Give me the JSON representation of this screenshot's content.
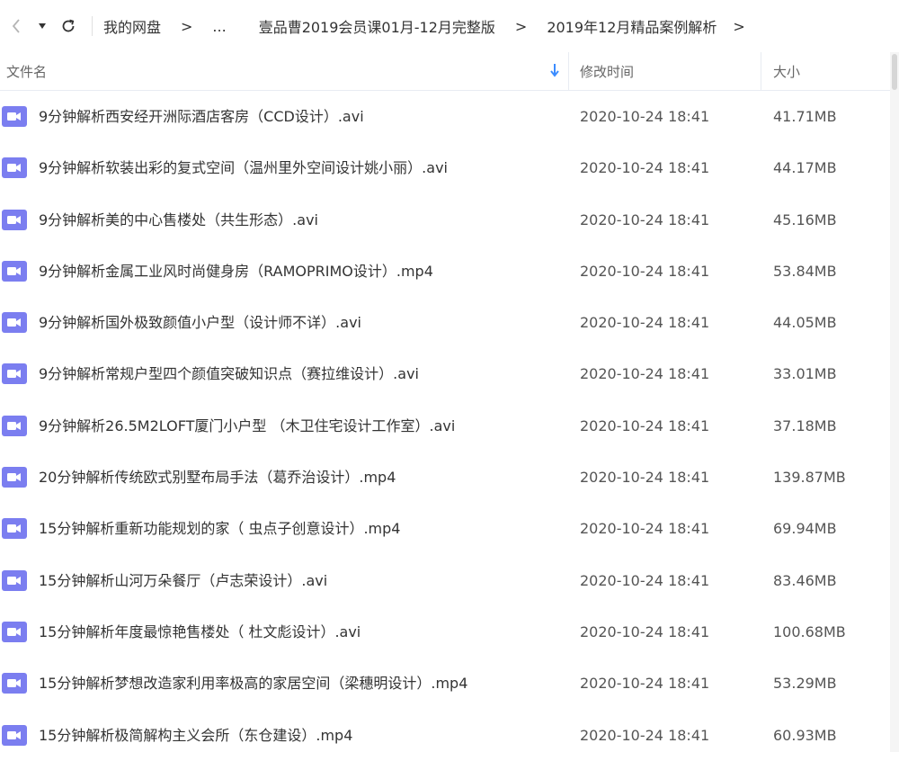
{
  "colors": {
    "accent": "#3b8cff",
    "video_icon": "#7b7ef0",
    "header_text": "#666666"
  },
  "breadcrumb": {
    "items": [
      "我的网盘",
      "...",
      "壹品曹2019会员课01月-12月完整版",
      "2019年12月精品案例解析"
    ],
    "separator": ">"
  },
  "columns": {
    "name": "文件名",
    "time": "修改时间",
    "size": "大小"
  },
  "files": [
    {
      "name": "9分钟解析西安经开洲际酒店客房（CCD设计）.avi",
      "time": "2020-10-24 18:41",
      "size": "41.71MB"
    },
    {
      "name": "9分钟解析软装出彩的复式空间（温州里外空间设计姚小丽）.avi",
      "time": "2020-10-24 18:41",
      "size": "44.17MB"
    },
    {
      "name": "9分钟解析美的中心售楼处（共生形态）.avi",
      "time": "2020-10-24 18:41",
      "size": "45.16MB"
    },
    {
      "name": "9分钟解析金属工业风时尚健身房（RAMOPRIMO设计）.mp4",
      "time": "2020-10-24 18:41",
      "size": "53.84MB"
    },
    {
      "name": "9分钟解析国外极致颜值小户型（设计师不详）.avi",
      "time": "2020-10-24 18:41",
      "size": "44.05MB"
    },
    {
      "name": "9分钟解析常规户型四个颜值突破知识点（赛拉维设计）.avi",
      "time": "2020-10-24 18:41",
      "size": "33.01MB"
    },
    {
      "name": "9分钟解析26.5M2LOFT厦门小户型 （木卫住宅设计工作室）.avi",
      "time": "2020-10-24 18:41",
      "size": "37.18MB"
    },
    {
      "name": "20分钟解析传统欧式别墅布局手法（葛乔治设计）.mp4",
      "time": "2020-10-24 18:41",
      "size": "139.87MB"
    },
    {
      "name": "15分钟解析重新功能规划的家（ 虫点子创意设计）.mp4",
      "time": "2020-10-24 18:41",
      "size": "69.94MB"
    },
    {
      "name": "15分钟解析山河万朵餐厅（卢志荣设计）.avi",
      "time": "2020-10-24 18:41",
      "size": "83.46MB"
    },
    {
      "name": "15分钟解析年度最惊艳售楼处（ 杜文彪设计）.avi",
      "time": "2020-10-24 18:41",
      "size": "100.68MB"
    },
    {
      "name": "15分钟解析梦想改造家利用率极高的家居空间（梁穗明设计）.mp4",
      "time": "2020-10-24 18:41",
      "size": "53.29MB"
    },
    {
      "name": "15分钟解析极简解构主义会所（东仓建设）.mp4",
      "time": "2020-10-24 18:41",
      "size": "60.93MB"
    }
  ]
}
